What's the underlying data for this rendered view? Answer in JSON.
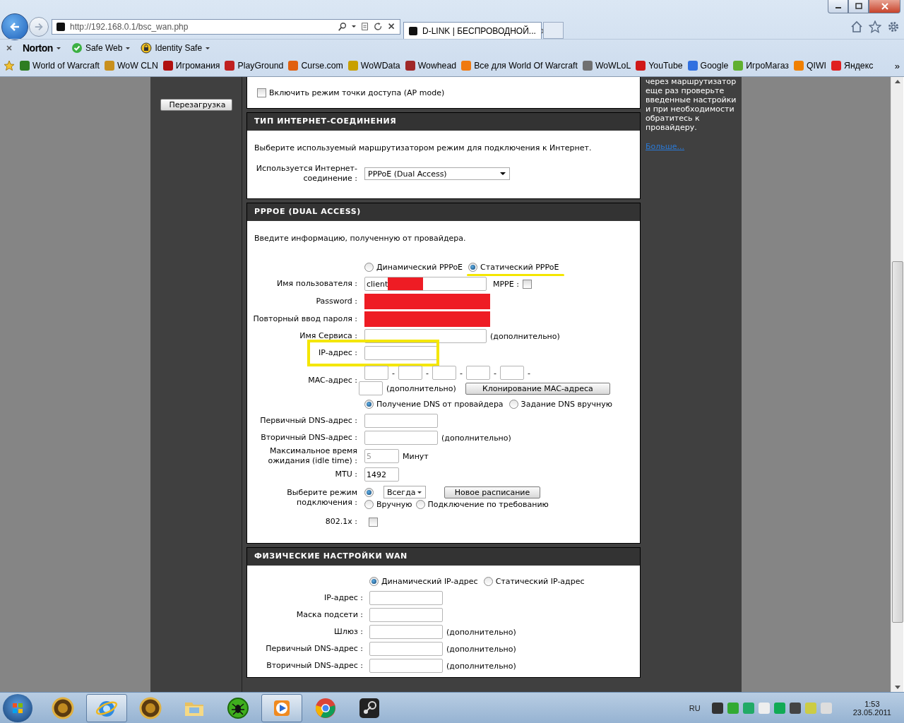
{
  "browser": {
    "url": "http://192.168.0.1/bsc_wan.php",
    "tab_title": "D-LINK | БЕСПРОВОДНОЙ...",
    "toolbar": [
      {
        "label": "Norton",
        "kind": "brand"
      },
      {
        "label": "Safe Web",
        "kind": "safe"
      },
      {
        "label": "Identity Safe",
        "kind": "lock"
      }
    ],
    "favorites": [
      {
        "label": "World of Warcraft",
        "color": "#2e7d22"
      },
      {
        "label": "WoW CLN",
        "color": "#c8901e"
      },
      {
        "label": "Игромания",
        "color": "#b01010"
      },
      {
        "label": "PlayGround",
        "color": "#c02020"
      },
      {
        "label": "Curse.com",
        "color": "#e06010"
      },
      {
        "label": "WoWData",
        "color": "#c8a000"
      },
      {
        "label": "Wowhead",
        "color": "#a02828"
      },
      {
        "label": "Все для World Of Warcraft",
        "color": "#f07a10"
      },
      {
        "label": "WoWLoL",
        "color": "#707070"
      },
      {
        "label": "YouTube",
        "color": "#d01818"
      },
      {
        "label": "Google",
        "color": "#3070e0"
      },
      {
        "label": "ИгроМагаз",
        "color": "#60b030"
      },
      {
        "label": "QIWI",
        "color": "#f08000"
      },
      {
        "label": "Яндекс",
        "color": "#e02020"
      }
    ],
    "more": "»"
  },
  "sidebar": {
    "button": "Перезагрузка"
  },
  "ap_mode": {
    "label": "Включить режим точки доступа (AP mode)",
    "checked": false
  },
  "connection_type": {
    "title": "ТИП ИНТЕРНЕТ-СОЕДИНЕНИЯ",
    "description": "Выберите используемый маршрутизатором режим для подключения к Интернет.",
    "label": "Используется Интернет-соединение :",
    "value": "PPPoE (Dual Access)"
  },
  "pppoe": {
    "title": "PPPOE (DUAL ACCESS)",
    "description": "Введите информацию, полученную от провайдера.",
    "rows": [
      {
        "kind": "radios",
        "options": [
          {
            "label": "Динамический PPPoE",
            "selected": false
          },
          {
            "label": "Статический PPPoE",
            "selected": true,
            "highlighted": true
          }
        ]
      },
      {
        "kind": "field",
        "label": "Имя пользователя :",
        "value": "client",
        "redacted": true,
        "checkbox": {
          "label": "MPPE :",
          "checked": false
        }
      },
      {
        "kind": "field",
        "label": "Password :",
        "redacted": true
      },
      {
        "kind": "field",
        "label": "Повторный ввод пароля :",
        "redacted": true
      },
      {
        "kind": "field",
        "label": "Имя Сервиса :",
        "note": "(дополнительно)"
      },
      {
        "kind": "short_field",
        "label": "IP-адрес :",
        "highlighted": true
      },
      {
        "kind": "mac",
        "label": "MAC-адрес :",
        "separators": [
          "-",
          "-",
          "-",
          "-",
          "-"
        ],
        "note": "(дополнительно)",
        "button": "Клонирование MAC-адреса"
      },
      {
        "kind": "radios",
        "options": [
          {
            "label": "Получение DNS от провайдера",
            "selected": true
          },
          {
            "label": "Задание DNS вручную",
            "selected": false
          }
        ]
      },
      {
        "kind": "short_field",
        "label": "Первичный DNS-адрес :"
      },
      {
        "kind": "short_field",
        "label": "Вторичный DNS-адрес :",
        "note": "(дополнительно)"
      },
      {
        "kind": "tiny_field",
        "label": "Максимальное время ожидания (idle time) :",
        "value": "5",
        "disabled": true,
        "note": "Минут"
      },
      {
        "kind": "tiny_field",
        "label": "MTU :",
        "value": "1492",
        "disabled": false
      },
      {
        "kind": "schedule",
        "label": "Выберите режим подключения :",
        "selected": true,
        "select_value": "Всегда",
        "button": "Новое расписание",
        "options": [
          {
            "label": "Вручную",
            "selected": false
          },
          {
            "label": "Подключение по требованию",
            "selected": false
          }
        ]
      },
      {
        "kind": "checkbox",
        "label": "802.1x :",
        "checked": false
      }
    ]
  },
  "wan": {
    "title": "ФИЗИЧЕСКИЕ НАСТРОЙКИ WAN",
    "rows": [
      {
        "kind": "radios",
        "options": [
          {
            "label": "Динамический IP-адрес",
            "selected": true
          },
          {
            "label": "Статический IP-адрес",
            "selected": false
          }
        ]
      },
      {
        "kind": "short_field",
        "label": "IP-адрес :"
      },
      {
        "kind": "short_field",
        "label": "Маска подсети :"
      },
      {
        "kind": "short_field",
        "label": "Шлюз :",
        "note": "(дополнительно)"
      },
      {
        "kind": "short_field",
        "label": "Первичный DNS-адрес :",
        "note": "(дополнительно)"
      },
      {
        "kind": "short_field",
        "label": "Вторичный DNS-адрес :",
        "note": "(дополнительно)"
      }
    ]
  },
  "help": {
    "text": "через маршрутизатор еще раз проверьте введенные настройки и при необходимости обратитесь к провайдеру.",
    "link": "Больше..."
  },
  "taskbar": {
    "items": [
      {
        "kind": "emblem",
        "open": false
      },
      {
        "kind": "globe",
        "open": true
      },
      {
        "kind": "emblem",
        "open": false
      },
      {
        "kind": "folder",
        "open": false
      },
      {
        "kind": "spider",
        "open": false
      },
      {
        "kind": "player",
        "open": true
      },
      {
        "kind": "wheel",
        "open": false
      },
      {
        "kind": "tile",
        "open": false
      }
    ],
    "language": "RU",
    "time": "1:53",
    "date": "23.05.2011"
  }
}
